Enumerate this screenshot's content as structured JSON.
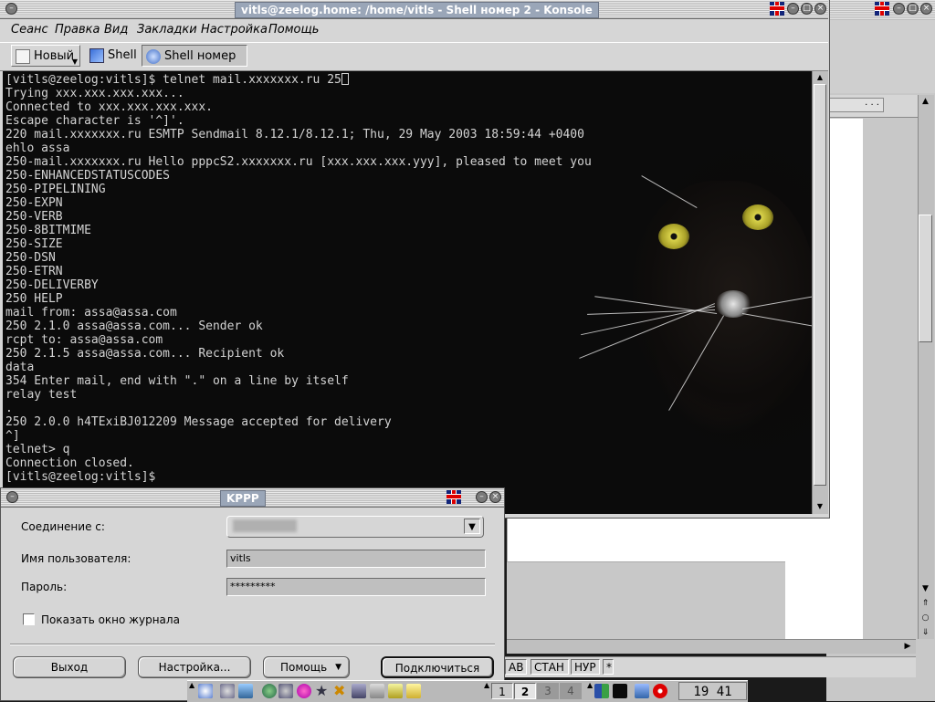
{
  "background_app": {
    "window_title": "",
    "status_segments": [
      "AB",
      "СТАН",
      "НУР",
      "*"
    ]
  },
  "konsole": {
    "title": "vitls@zeelog.home: /home/vitls - Shell номер 2 - Konsole",
    "menu": [
      "Сеанс",
      "Правка",
      "Вид",
      "Закладки",
      "Настройка",
      "Помощь"
    ],
    "toolbar": {
      "new_label": "Новый",
      "tabs": [
        "Shell",
        "Shell номер 2"
      ],
      "active_tab": 1
    },
    "terminal_lines": [
      "[vitls@zeelog:vitls]$ telnet mail.xxxxxxx.ru 25",
      "Trying xxx.xxx.xxx.xxx...",
      "Connected to xxx.xxx.xxx.xxx.",
      "Escape character is '^]'.",
      "220 mail.xxxxxxx.ru ESMTP Sendmail 8.12.1/8.12.1; Thu, 29 May 2003 18:59:44 +0400",
      "ehlo assa",
      "250-mail.xxxxxxx.ru Hello pppcS2.xxxxxxx.ru [xxx.xxx.xxx.yyy], pleased to meet you",
      "250-ENHANCEDSTATUSCODES",
      "250-PIPELINING",
      "250-EXPN",
      "250-VERB",
      "250-8BITMIME",
      "250-SIZE",
      "250-DSN",
      "250-ETRN",
      "250-DELIVERBY",
      "250 HELP",
      "mail from: assa@assa.com",
      "250 2.1.0 assa@assa.com... Sender ok",
      "rcpt to: assa@assa.com",
      "250 2.1.5 assa@assa.com... Recipient ok",
      "data",
      "354 Enter mail, end with \".\" on a line by itself",
      "relay test",
      ".",
      "250 2.0.0 h4TExiBJ012209 Message accepted for delivery",
      "^]",
      "telnet> q",
      "Connection closed.",
      "[vitls@zeelog:vitls]$"
    ]
  },
  "kppp": {
    "title": "KPPP",
    "connection_label": "Соединение с:",
    "connection_value": "",
    "username_label": "Имя пользователя:",
    "username_value": "vitls",
    "password_label": "Пароль:",
    "password_value": "*********",
    "show_log_label": "Показать окно журнала",
    "show_log_checked": false,
    "buttons": {
      "quit": "Выход",
      "setup": "Настройка...",
      "help": "Помощь",
      "connect": "Подключиться"
    }
  },
  "taskbar": {
    "desktops": [
      "1",
      "2",
      "3",
      "4"
    ],
    "active_desktop": 1,
    "clock": "19 41"
  },
  "colors": {
    "terminal_bg": "#0b0b0b",
    "terminal_fg": "#d4d4d4",
    "title_accent": "#9aa6b8",
    "chrome": "#d6d6d6"
  }
}
